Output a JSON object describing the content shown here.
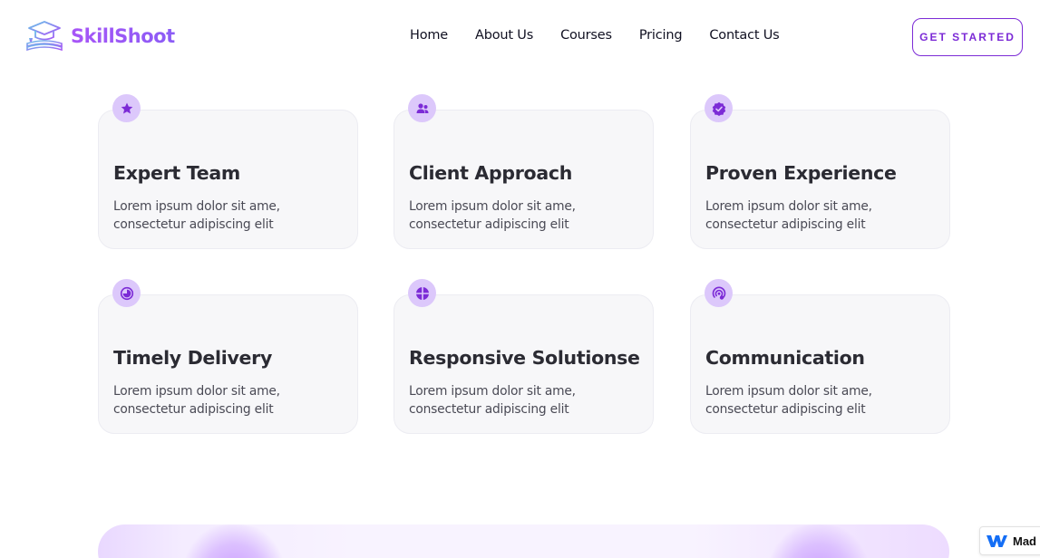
{
  "brand": {
    "name": "SkillShoot",
    "logo_icon": "graduation-cap-books-icon",
    "gradient": [
      "#a855f7",
      "#8b5cf6"
    ]
  },
  "nav": {
    "items": [
      {
        "label": "Home"
      },
      {
        "label": "About Us"
      },
      {
        "label": "Courses"
      },
      {
        "label": "Pricing"
      },
      {
        "label": "Contact Us"
      }
    ]
  },
  "cta": {
    "label": "GET STARTED",
    "color": "#7c2bd6"
  },
  "features": [
    {
      "title": "Expert Team",
      "desc": "Lorem ipsum dolor sit ame, consectetur adipiscing elit",
      "icon": "star-icon"
    },
    {
      "title": "Client Approach",
      "desc": "Lorem ipsum dolor sit ame, consectetur adipiscing elit",
      "icon": "users-icon"
    },
    {
      "title": "Proven Experience",
      "desc": "Lorem ipsum dolor sit ame, consectetur adipiscing elit",
      "icon": "verified-badge-icon"
    },
    {
      "title": "Timely Delivery",
      "desc": "Lorem ipsum dolor sit ame, consectetur adipiscing elit",
      "icon": "clock-icon"
    },
    {
      "title": "Responsive Solutionse",
      "desc": "Lorem ipsum dolor sit ame, consectetur adipiscing elit",
      "icon": "pie-chart-icon"
    },
    {
      "title": "Communication",
      "desc": "Lorem ipsum dolor sit ame, consectetur adipiscing elit",
      "icon": "broadcast-icon"
    }
  ],
  "colors": {
    "accent": "#7c2bd6",
    "badge_bg": "#dcc8fb",
    "card_bg": "#f7f7f9"
  },
  "made_in_badge": {
    "label": "Mad",
    "icon": "webflow-icon"
  }
}
